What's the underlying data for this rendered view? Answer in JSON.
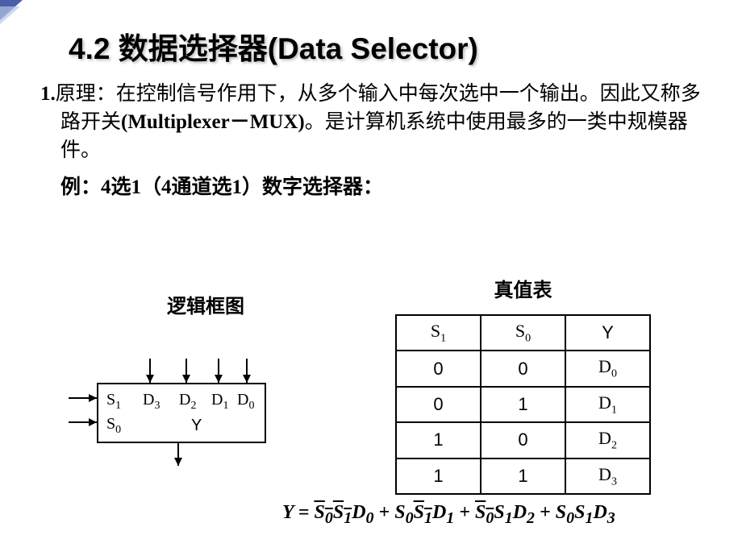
{
  "title": "4.2 数据选择器(Data Selector)",
  "principle_label": "1.",
  "principle_text": "原理：在控制信号作用下，从多个输入中每次选中一个输出。因此又称多路开关",
  "principle_text2": "(Multiplexer－MUX)",
  "principle_text3": "。是计算机系统中使用最多的一类中规模器件。",
  "example_text": "例：4选1（4通道选1）数字选择器：",
  "diagram_title": "逻辑框图",
  "truth_title": "真值表",
  "mux": {
    "s1": "S",
    "s1_sub": "1",
    "s0": "S",
    "s0_sub": "0",
    "d3": "D",
    "d3_sub": "3",
    "d2": "D",
    "d2_sub": "2",
    "d1": "D",
    "d1_sub": "1",
    "d0": "D",
    "d0_sub": "0",
    "y": "Y"
  },
  "truth_table": {
    "headers": {
      "c1": "S",
      "c1_sub": "1",
      "c2": "S",
      "c2_sub": "0",
      "c3": "Y"
    },
    "rows": [
      {
        "s1": "0",
        "s0": "0",
        "y": "D",
        "y_sub": "0"
      },
      {
        "s1": "0",
        "s0": "1",
        "y": "D",
        "y_sub": "1"
      },
      {
        "s1": "1",
        "s0": "0",
        "y": "D",
        "y_sub": "2"
      },
      {
        "s1": "1",
        "s0": "1",
        "y": "D",
        "y_sub": "3"
      }
    ]
  },
  "equation": {
    "lhs": "Y",
    "eq": " = ",
    "t1_a": "S",
    "t1_a_sub": "0",
    "t1_b": "S",
    "t1_b_sub": "1",
    "t1_c": "D",
    "t1_c_sub": "0",
    "plus": " + ",
    "t2_a": "S",
    "t2_a_sub": "0",
    "t2_b": "S",
    "t2_b_sub": "1",
    "t2_c": "D",
    "t2_c_sub": "1",
    "t3_a": "S",
    "t3_a_sub": "0",
    "t3_b": "S",
    "t3_b_sub": "1",
    "t3_c": "D",
    "t3_c_sub": "2",
    "t4_a": "S",
    "t4_a_sub": "0",
    "t4_b": "S",
    "t4_b_sub": "1",
    "t4_c": "D",
    "t4_c_sub": "3"
  }
}
